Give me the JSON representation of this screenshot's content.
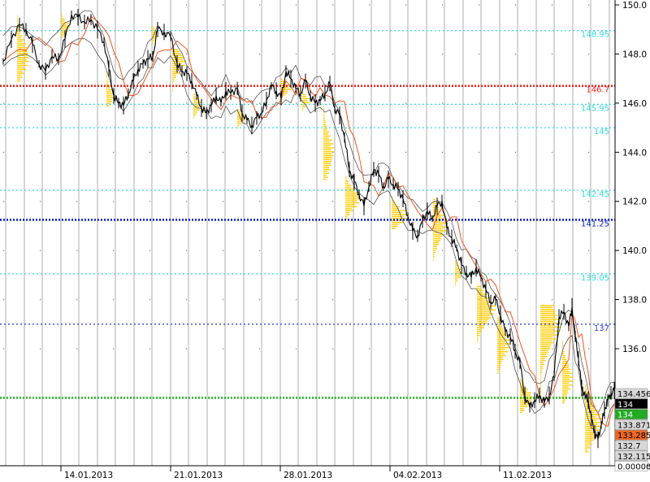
{
  "chart_data": {
    "type": "line",
    "description_type": "candlestick price chart with market-profile histograms and envelope bands",
    "ylim": [
      131.5,
      150.1
    ],
    "x_tick_labels": [
      "14.01.2013",
      "21.01.2013",
      "28.01.2013",
      "04.02.2013",
      "11.02.2013"
    ],
    "y_tick_labels": [
      {
        "value": 136,
        "label": "136.0"
      },
      {
        "value": 138,
        "label": "138.0"
      },
      {
        "value": 140,
        "label": "140.0"
      },
      {
        "value": 142,
        "label": "142.0"
      },
      {
        "value": 144,
        "label": "144.0"
      },
      {
        "value": 146,
        "label": "146.0"
      },
      {
        "value": 148,
        "label": "148.0"
      },
      {
        "value": 150,
        "label": "150.0"
      }
    ],
    "horizontal_levels": [
      {
        "value": 148.95,
        "label": "148.95",
        "color": "#33dddd",
        "style": "dotted"
      },
      {
        "value": 146.7,
        "label": "146.7",
        "color": "#ee2222",
        "style": "dotted-bold"
      },
      {
        "value": 145.95,
        "label": "145.95",
        "color": "#33dddd",
        "style": "dotted"
      },
      {
        "value": 145,
        "label": "145",
        "color": "#33dddd",
        "style": "dotted"
      },
      {
        "value": 142.45,
        "label": "142.45",
        "color": "#33dddd",
        "style": "dotted"
      },
      {
        "value": 141.25,
        "label": "141.25",
        "color": "#1122cc",
        "style": "dotted-bold"
      },
      {
        "value": 139.05,
        "label": "139.05",
        "color": "#33dddd",
        "style": "dotted"
      },
      {
        "value": 137,
        "label": "137",
        "color": "#3344dd",
        "style": "dotted"
      },
      {
        "value": 134,
        "label": "",
        "color": "#22bb22",
        "style": "dotted-bold"
      }
    ],
    "price_path": [
      [
        0,
        147.7
      ],
      [
        10,
        148.6
      ],
      [
        20,
        149.2
      ],
      [
        28,
        149.0
      ],
      [
        36,
        148.4
      ],
      [
        44,
        147.6
      ],
      [
        52,
        147.3
      ],
      [
        60,
        147.9
      ],
      [
        68,
        147.8
      ],
      [
        76,
        148.6
      ],
      [
        84,
        149.6
      ],
      [
        92,
        149.5
      ],
      [
        100,
        149.3
      ],
      [
        108,
        149.4
      ],
      [
        116,
        149.0
      ],
      [
        124,
        148.5
      ],
      [
        130,
        147.4
      ],
      [
        136,
        146.3
      ],
      [
        142,
        146.0
      ],
      [
        148,
        145.9
      ],
      [
        154,
        146.4
      ],
      [
        160,
        146.9
      ],
      [
        166,
        147.4
      ],
      [
        172,
        147.6
      ],
      [
        178,
        147.8
      ],
      [
        184,
        147.9
      ],
      [
        190,
        149.0
      ],
      [
        198,
        148.9
      ],
      [
        206,
        148.7
      ],
      [
        214,
        147.6
      ],
      [
        220,
        147.3
      ],
      [
        226,
        147.2
      ],
      [
        232,
        146.9
      ],
      [
        238,
        146.3
      ],
      [
        244,
        145.8
      ],
      [
        250,
        145.6
      ],
      [
        256,
        145.9
      ],
      [
        262,
        146.3
      ],
      [
        268,
        146.0
      ],
      [
        274,
        146.5
      ],
      [
        280,
        146.4
      ],
      [
        288,
        146.6
      ],
      [
        294,
        145.6
      ],
      [
        300,
        145.3
      ],
      [
        306,
        145.1
      ],
      [
        312,
        145.4
      ],
      [
        318,
        145.6
      ],
      [
        324,
        146.1
      ],
      [
        330,
        146.7
      ],
      [
        336,
        146.5
      ],
      [
        342,
        146.2
      ],
      [
        348,
        147.3
      ],
      [
        354,
        147.0
      ],
      [
        360,
        146.6
      ],
      [
        366,
        146.4
      ],
      [
        372,
        146.9
      ],
      [
        378,
        146.3
      ],
      [
        384,
        146.0
      ],
      [
        390,
        146.1
      ],
      [
        396,
        146.4
      ],
      [
        402,
        146.8
      ],
      [
        408,
        145.8
      ],
      [
        414,
        145.5
      ],
      [
        420,
        144.6
      ],
      [
        426,
        143.3
      ],
      [
        432,
        142.8
      ],
      [
        438,
        142.3
      ],
      [
        444,
        141.8
      ],
      [
        450,
        142.6
      ],
      [
        456,
        143.3
      ],
      [
        462,
        143.1
      ],
      [
        468,
        142.6
      ],
      [
        474,
        142.9
      ],
      [
        480,
        142.7
      ],
      [
        486,
        142.5
      ],
      [
        492,
        142.1
      ],
      [
        498,
        141.4
      ],
      [
        504,
        140.8
      ],
      [
        510,
        140.6
      ],
      [
        516,
        141.2
      ],
      [
        522,
        141.6
      ],
      [
        528,
        141.3
      ],
      [
        534,
        141.8
      ],
      [
        540,
        142.0
      ],
      [
        546,
        140.9
      ],
      [
        552,
        140.5
      ],
      [
        558,
        140.1
      ],
      [
        564,
        139.4
      ],
      [
        570,
        139.1
      ],
      [
        576,
        138.9
      ],
      [
        582,
        139.3
      ],
      [
        588,
        138.9
      ],
      [
        594,
        138.4
      ],
      [
        600,
        137.9
      ],
      [
        606,
        138.0
      ],
      [
        612,
        137.4
      ],
      [
        618,
        136.7
      ],
      [
        624,
        136.5
      ],
      [
        630,
        135.9
      ],
      [
        636,
        135.4
      ],
      [
        642,
        134.1
      ],
      [
        648,
        133.6
      ],
      [
        654,
        133.9
      ],
      [
        660,
        134.1
      ],
      [
        666,
        133.8
      ],
      [
        672,
        134.1
      ],
      [
        678,
        134.9
      ],
      [
        684,
        137.3
      ],
      [
        690,
        137.5
      ],
      [
        696,
        136.9
      ],
      [
        700,
        137.7
      ],
      [
        704,
        136.5
      ],
      [
        708,
        135.6
      ],
      [
        712,
        134.4
      ],
      [
        716,
        134.1
      ],
      [
        720,
        133.9
      ],
      [
        724,
        133.1
      ],
      [
        728,
        132.6
      ],
      [
        732,
        132.3
      ],
      [
        736,
        132.9
      ],
      [
        740,
        133.5
      ],
      [
        744,
        133.9
      ],
      [
        748,
        134.2
      ],
      [
        752,
        134.3
      ]
    ],
    "price_labels": [
      {
        "text": "134.456",
        "bg": "#d8d8d8",
        "fg": "#000000"
      },
      {
        "text": "134",
        "bg": "#000000",
        "fg": "#ffffff",
        "y": 134
      },
      {
        "text": "134",
        "bg": "#22aa22",
        "fg": "#ffffff"
      },
      {
        "text": "133.871",
        "bg": "#d8d8d8",
        "fg": "#000000"
      },
      {
        "text": "133.285",
        "bg": "#ee6622",
        "fg": "#000000"
      },
      {
        "text": "132.7",
        "bg": "#d8d8d8",
        "fg": "#000000"
      },
      {
        "text": "132.115",
        "bg": "#d8d8d8",
        "fg": "#000000"
      },
      {
        "text": "0.00000",
        "bg": "#ffffff",
        "fg": "#000000"
      }
    ],
    "colors": {
      "profile": "#ffcc00",
      "price": "#000000",
      "band": "#555555",
      "moving_average": "#ee5522",
      "grid": "#888888"
    }
  }
}
